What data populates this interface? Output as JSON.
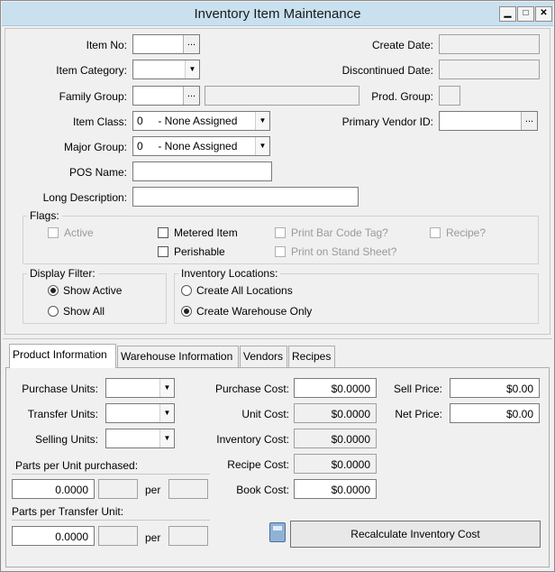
{
  "window": {
    "title": "Inventory Item Maintenance"
  },
  "header_fields": {
    "item_no_label": "Item No:",
    "item_category_label": "Item Category:",
    "family_group_label": "Family Group:",
    "item_class_label": "Item Class:",
    "item_class_value": "0     - None Assigned",
    "major_group_label": "Major Group:",
    "major_group_value": "0     - None Assigned",
    "pos_name_label": "POS Name:",
    "long_description_label": "Long Description:",
    "create_date_label": "Create Date:",
    "discontinued_date_label": "Discontinued Date:",
    "prod_group_label": "Prod. Group:",
    "primary_vendor_label": "Primary Vendor ID:",
    "ellipsis": "..."
  },
  "flags": {
    "title": "Flags:",
    "active": "Active",
    "metered_item": "Metered Item",
    "print_bar_code": "Print Bar Code Tag?",
    "recipe": "Recipe?",
    "perishable": "Perishable",
    "print_on_stand_sheet": "Print on Stand Sheet?"
  },
  "display_filter": {
    "title": "Display Filter:",
    "show_active": "Show Active",
    "show_all": "Show All",
    "selected": "show_active"
  },
  "inventory_locations": {
    "title": "Inventory Locations:",
    "create_all": "Create All Locations",
    "create_warehouse": "Create Warehouse Only",
    "selected": "create_warehouse"
  },
  "tabs": [
    "Product Information",
    "Warehouse Information",
    "Vendors",
    "Recipes"
  ],
  "product_info": {
    "purchase_units_label": "Purchase Units:",
    "transfer_units_label": "Transfer Units:",
    "selling_units_label": "Selling Units:",
    "parts_per_unit_label": "Parts per Unit purchased:",
    "parts_per_unit_value": "0.0000",
    "parts_per_transfer_label": "Parts per Transfer Unit:",
    "parts_per_transfer_value": "0.0000",
    "per": "per",
    "purchase_cost_label": "Purchase Cost:",
    "purchase_cost_value": "$0.0000",
    "unit_cost_label": "Unit Cost:",
    "unit_cost_value": "$0.0000",
    "inventory_cost_label": "Inventory Cost:",
    "inventory_cost_value": "$0.0000",
    "recipe_cost_label": "Recipe Cost:",
    "recipe_cost_value": "$0.0000",
    "book_cost_label": "Book Cost:",
    "book_cost_value": "$0.0000",
    "sell_price_label": "Sell Price:",
    "sell_price_value": "$0.00",
    "net_price_label": "Net Price:",
    "net_price_value": "$0.00",
    "recalculate_button": "Recalculate Inventory Cost"
  }
}
